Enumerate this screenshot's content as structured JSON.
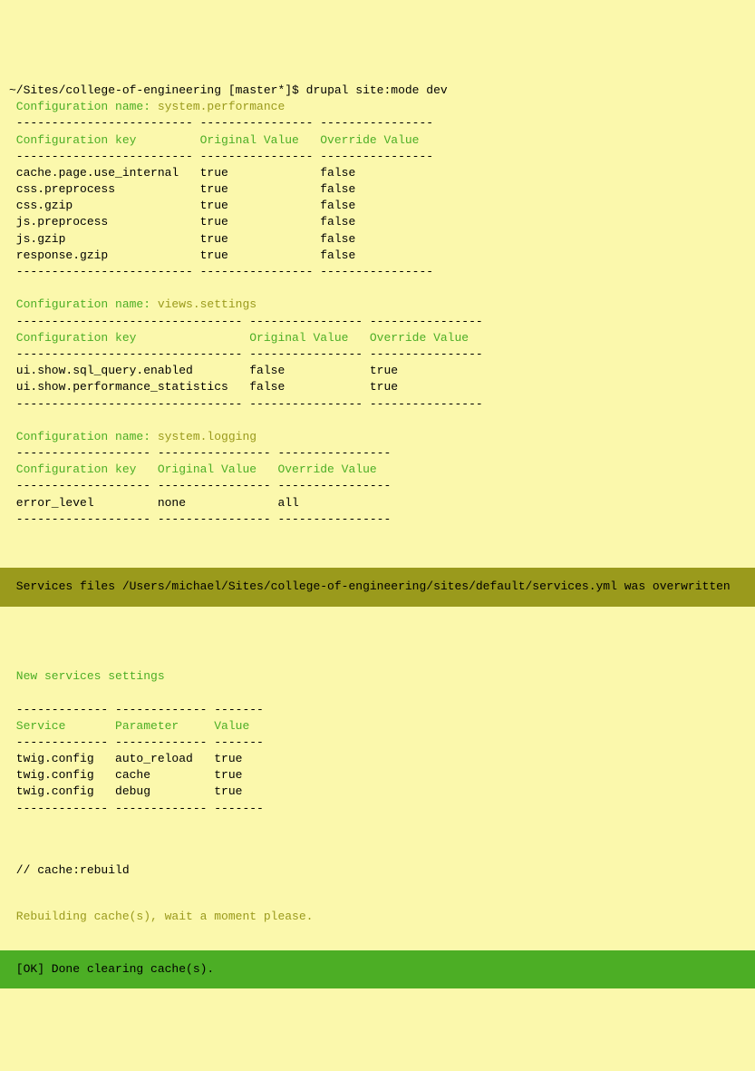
{
  "prompt": {
    "path": "~/Sites/college-of-engineering [master*]$",
    "command": " drupal site:mode dev"
  },
  "sections": [
    {
      "label": " Configuration name:",
      "name": "system.performance",
      "header": {
        "c1": " Configuration key",
        "c2": "Original Value",
        "c3": "Override Value"
      },
      "dash1": " ------------------------- ---------------- ----------------",
      "dash2": " ------------------------- ---------------- ----------------",
      "dash3": " ------------------------- ---------------- ----------------",
      "cols": [
        27,
        17,
        16
      ],
      "rows": [
        {
          "c1": " cache.page.use_internal",
          "c2": "true",
          "c3": "false"
        },
        {
          "c1": " css.preprocess",
          "c2": "true",
          "c3": "false"
        },
        {
          "c1": " css.gzip",
          "c2": "true",
          "c3": "false"
        },
        {
          "c1": " js.preprocess",
          "c2": "true",
          "c3": "false"
        },
        {
          "c1": " js.gzip",
          "c2": "true",
          "c3": "false"
        },
        {
          "c1": " response.gzip",
          "c2": "true",
          "c3": "false"
        }
      ]
    },
    {
      "label": " Configuration name:",
      "name": "views.settings",
      "header": {
        "c1": " Configuration key",
        "c2": "Original Value",
        "c3": "Override Value"
      },
      "dash1": " -------------------------------- ---------------- ----------------",
      "dash2": " -------------------------------- ---------------- ----------------",
      "dash3": " -------------------------------- ---------------- ----------------",
      "cols": [
        34,
        17,
        16
      ],
      "rows": [
        {
          "c1": " ui.show.sql_query.enabled",
          "c2": "false",
          "c3": "true"
        },
        {
          "c1": " ui.show.performance_statistics",
          "c2": "false",
          "c3": "true"
        }
      ]
    },
    {
      "label": " Configuration name:",
      "name": "system.logging",
      "header": {
        "c1": " Configuration key",
        "c2": "Original Value",
        "c3": "Override Value"
      },
      "dash1": " ------------------- ---------------- ----------------",
      "dash2": " ------------------- ---------------- ----------------",
      "dash3": " ------------------- ---------------- ----------------",
      "cols": [
        21,
        17,
        16
      ],
      "rows": [
        {
          "c1": " error_level",
          "c2": "none",
          "c3": "all"
        }
      ]
    }
  ],
  "overwriteBanner": " Services files /Users/michael/Sites/college-of-engineering/sites/default/services.yml was overwritten",
  "servicesSection": {
    "title": " New services settings",
    "header": {
      "c1": " Service",
      "c2": "Parameter",
      "c3": "Value"
    },
    "dash": " ------------- ------------- -------",
    "cols": [
      15,
      14,
      7
    ],
    "rows": [
      {
        "c1": " twig.config",
        "c2": "auto_reload",
        "c3": "true"
      },
      {
        "c1": " twig.config",
        "c2": "cache",
        "c3": "true"
      },
      {
        "c1": " twig.config",
        "c2": "debug",
        "c3": "true"
      }
    ]
  },
  "cacheRebuild": {
    "comment": " // cache:rebuild",
    "wait": " Rebuilding cache(s), wait a moment please."
  },
  "okBanner": " [OK] Done clearing cache(s)."
}
